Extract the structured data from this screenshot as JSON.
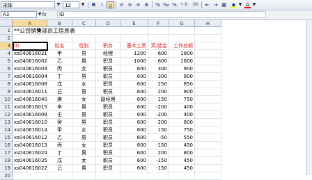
{
  "toolbar": {
    "font_name": "宋体",
    "font_size": "12",
    "buttons": [
      "B",
      "I",
      "U",
      "≡",
      "≡",
      "≡",
      "⊞",
      "%",
      "‰",
      "%",
      "+.0",
      ".00",
      "⇤",
      "⇥",
      "▦",
      "A"
    ],
    "fill_color": "#ffff00",
    "font_color": "#ff0000"
  },
  "formula_bar": {
    "name_box": "A3",
    "fx": "fx",
    "value": "ID"
  },
  "columns": [
    "A",
    "B",
    "C",
    "D",
    "E",
    "F",
    "G",
    "H"
  ],
  "selected_column": "A",
  "rows": [
    "1",
    "2",
    "3",
    "4",
    "5",
    "6",
    "7",
    "8",
    "9",
    "10",
    "11",
    "12",
    "13",
    "14",
    "15",
    "16",
    "17",
    "18",
    "19",
    "20"
  ],
  "selected_row": "3",
  "title": "**公司销售部员工信息表",
  "header": [
    "ID",
    "姓名",
    "性别",
    "职务",
    "基本工资",
    "奖/惩金",
    "工作总额"
  ],
  "records": [
    [
      "xs040616021",
      "甲",
      "男",
      "经理",
      "1200",
      "600",
      "1800"
    ],
    [
      "xs040616002",
      "乙",
      "男",
      "职员",
      "1000",
      "600",
      "1600"
    ],
    [
      "xs040616003",
      "丙",
      "女",
      "职员",
      "600",
      "300",
      "900"
    ],
    [
      "xs040616004",
      "丁",
      "男",
      "职员",
      "600",
      "300",
      "900"
    ],
    [
      "xs040616008",
      "戊",
      "女",
      "职员",
      "600",
      "250",
      "850"
    ],
    [
      "xs040616011",
      "己",
      "男",
      "职员",
      "600",
      "200",
      "800"
    ],
    [
      "xs040616040",
      "庚",
      "女",
      "副经理",
      "600",
      "150",
      "750"
    ],
    [
      "xs040616015",
      "辛",
      "男",
      "职员",
      "600",
      "-200",
      "400"
    ],
    [
      "xs040616009",
      "壬",
      "男",
      "职员",
      "600",
      "-200",
      "400"
    ],
    [
      "xs040616010",
      "癸",
      "男",
      "职员",
      "600",
      "200",
      "800"
    ],
    [
      "xs040616014",
      "甲",
      "女",
      "职员",
      "600",
      "150",
      "750"
    ],
    [
      "xs040616012",
      "乙",
      "男",
      "职员",
      "600",
      "-50",
      "550"
    ],
    [
      "xs040616013",
      "丙",
      "女",
      "职员",
      "600",
      "-150",
      "450"
    ],
    [
      "xs040616024",
      "丁",
      "男",
      "职员",
      "600",
      "200",
      "800"
    ],
    [
      "xs040616035",
      "戊",
      "女",
      "职员",
      "600",
      "-150",
      "450"
    ],
    [
      "xs040616022",
      "己",
      "男",
      "职员",
      "600",
      "-150",
      "450"
    ]
  ]
}
